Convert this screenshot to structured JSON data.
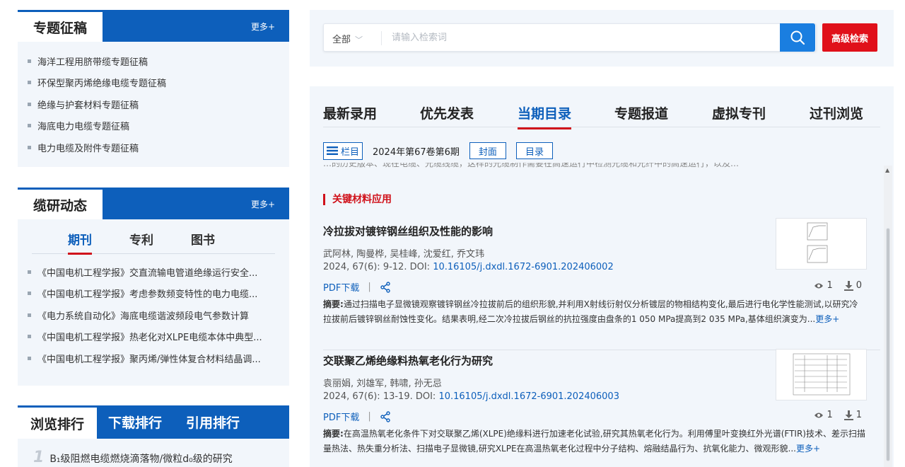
{
  "special_topics": {
    "title": "专题征稿",
    "more": "更多+",
    "items": [
      "海洋工程用脐带缆专题征稿",
      "环保型聚丙烯绝缘电缆专题征稿",
      "绝缘与护套材料专题征稿",
      "海底电力电缆专题征稿",
      "电力电缆及附件专题征稿"
    ]
  },
  "research_news": {
    "title": "缆研动态",
    "more": "更多+",
    "tabs": [
      "期刊",
      "专利",
      "图书"
    ],
    "active_tab": "期刊",
    "items": [
      "《中国电机工程学报》交直流输电管道绝缘运行安全...",
      "《中国电机工程学报》考虑参数频变特性的电力电缆...",
      "《电力系统自动化》海底电缆谐波频段电气参数计算",
      "《中国电机工程学报》热老化对XLPE电缆本体中典型...",
      "《中国电机工程学报》聚丙烯/弹性体复合材料结晶调..."
    ]
  },
  "ranking": {
    "tabs": [
      "浏览排行",
      "下载排行",
      "引用排行"
    ],
    "first_rank": "1",
    "first_title": "B₁级阻燃电缆燃烧滴落物/微粒d₀级的研究"
  },
  "search": {
    "scope": "全部",
    "placeholder": "请输入检索词",
    "advanced_label": "高级检索"
  },
  "main_tabs": [
    "最新录用",
    "优先发表",
    "当期目录",
    "专题报道",
    "虚拟专刊",
    "过刊浏览"
  ],
  "active_main_tab": "当期目录",
  "toolbar": {
    "column_label": "栏目",
    "issue": "2024年第67卷第6期",
    "cover_label": "封面",
    "toc_label": "目录"
  },
  "clipped_text": "…的历史版本、现在电缆、光缆线缆，这样的光缆制作需要在高速运行中检测光缆和光纤中的高速运行，以及…",
  "section": "关键材料应用",
  "articles": [
    {
      "title": "冷拉拔对镀锌钢丝组织及性能的影响",
      "authors": "武阿林, 陶曼桦, 吴桂峰, 沈爱红, 乔文玮",
      "citation": "2024, 67(6): 9-12. DOI: ",
      "doi": "10.16105/j.dxdl.1672-6901.202406002",
      "pdf_label": "PDF下载",
      "views": "1",
      "downloads": "0",
      "abstract_label": "摘要:",
      "abstract": "通过扫描电子显微镜观察镀锌钢丝冷拉拔前后的组织形貌,并利用X射线衍射仪分析镀层的物相结构变化,最后进行电化学性能测试,以研究冷拉拔前后镀锌钢丝耐蚀性变化。结果表明,经二次冷拉拔后钢丝的抗拉强度由盘条的1 050 MPa提高到2 035 MPa,基体组织演变为...",
      "more": "更多+"
    },
    {
      "title": "交联聚乙烯绝缘料热氧老化行为研究",
      "authors": "袁丽娟, 刘雄军, 韩啸, 孙无忌",
      "citation": "2024, 67(6): 13-19. DOI: ",
      "doi": "10.16105/j.dxdl.1672-6901.202406003",
      "pdf_label": "PDF下载",
      "views": "1",
      "downloads": "1",
      "abstract_label": "摘要:",
      "abstract": "在高温热氧老化条件下对交联聚乙烯(XLPE)绝缘料进行加速老化试验,研究其热氧老化行为。利用傅里叶变换红外光谱(FTIR)技术、差示扫描量热法、热失重分析法、扫描电子显微镜,研究XLPE在高温热氧老化过程中分子结构、熔融结晶行为、抗氧化能力、微观形貌...",
      "more": "更多+"
    }
  ],
  "colors": {
    "brand_blue": "#0d5fbb",
    "accent_red": "#d0121b",
    "search_blue": "#1a7ee0",
    "panel_bg": "#f2f6fb"
  }
}
